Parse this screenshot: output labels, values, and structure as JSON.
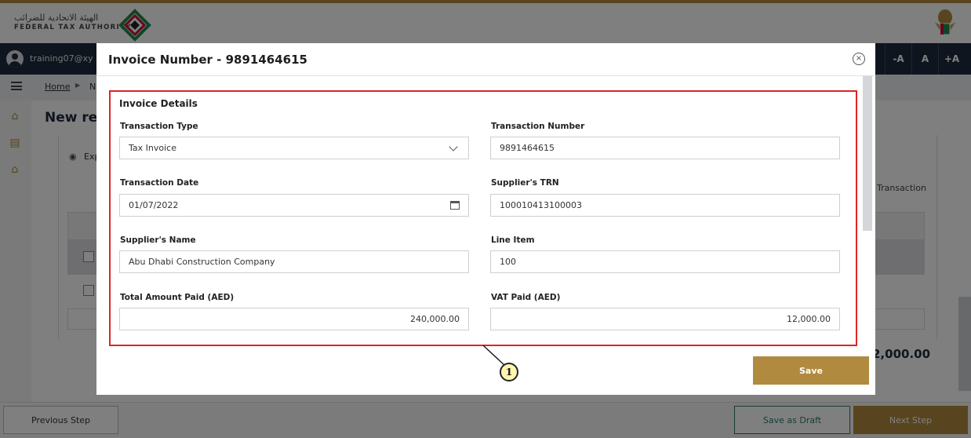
{
  "header": {
    "logo_arabic": "الهيئة الاتحادية للضرائب",
    "logo_english": "FEDERAL TAX AUTHORITY"
  },
  "user": {
    "email": "training07@xy"
  },
  "font_size_controls": [
    "-A",
    "A",
    "+A"
  ],
  "breadcrumb": {
    "home": "Home",
    "separator": "▶",
    "next": "N"
  },
  "page": {
    "title": "New resi",
    "expand_label": "Exp",
    "column_transaction": "Transaction",
    "total_value": "2,000.00"
  },
  "footer": {
    "previous": "Previous Step",
    "save_draft": "Save as Draft",
    "next": "Next Step"
  },
  "modal": {
    "title": "Invoice Number - 9891464615",
    "close_symbol": "×",
    "section_title": "Invoice Details",
    "fields": {
      "transaction_type": {
        "label": "Transaction Type",
        "value": "Tax Invoice"
      },
      "transaction_number": {
        "label": "Transaction Number",
        "value": "9891464615"
      },
      "transaction_date": {
        "label": "Transaction Date",
        "value": "01/07/2022"
      },
      "supplier_trn": {
        "label": "Supplier's TRN",
        "value": "100010413100003"
      },
      "supplier_name": {
        "label": "Supplier's Name",
        "value": "Abu Dhabi Construction Company"
      },
      "line_item": {
        "label": "Line Item",
        "value": "100"
      },
      "total_amount": {
        "label": "Total Amount Paid (AED)",
        "value": "240,000.00"
      },
      "vat_paid": {
        "label": "VAT Paid (AED)",
        "value": "12,000.00"
      }
    },
    "save_label": "Save"
  },
  "callout": {
    "number": "1"
  },
  "colors": {
    "gold": "#b08a3e",
    "navy": "#1e2b3c",
    "highlight_red": "#e02424",
    "teal": "#2c7a6f"
  }
}
